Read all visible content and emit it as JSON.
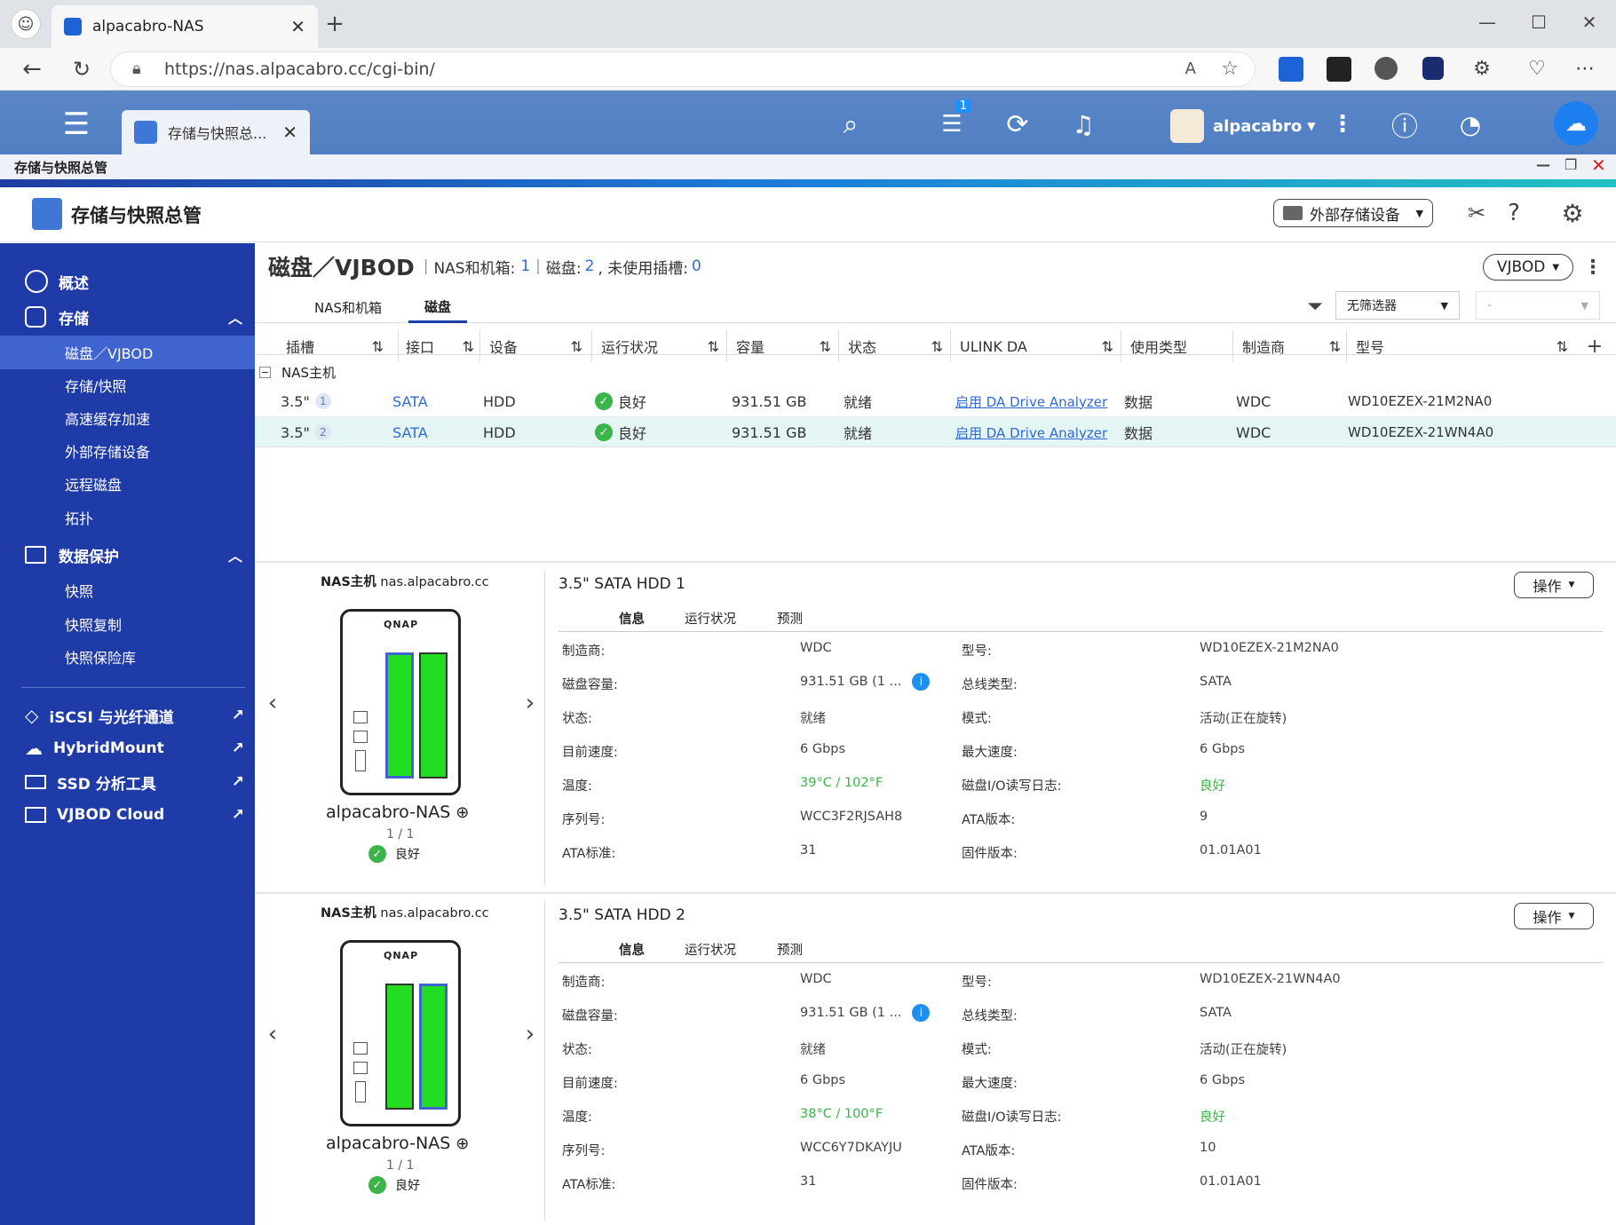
{
  "browser": {
    "tab_title": "alpacabro-NAS",
    "url": "https://nas.alpacabro.cc/cgi-bin/"
  },
  "qts": {
    "app_tab_label": "存储与快照总...",
    "notify_count": "1",
    "user": "alpacabro"
  },
  "window": {
    "title": "存储与快照总管",
    "app_title": "存储与快照总管",
    "external_btn": "外部存储设备"
  },
  "sidebar": {
    "overview": "概述",
    "storage": "存储",
    "storage_items": [
      "磁盘／VJBOD",
      "存储/快照",
      "高速缓存加速",
      "外部存储设备",
      "远程磁盘",
      "拓扑"
    ],
    "data_protection": "数据保护",
    "dp_items": [
      "快照",
      "快照复制",
      "快照保险库"
    ],
    "links": [
      "iSCSI 与光纤通道",
      "HybridMount",
      "SSD 分析工具",
      "VJBOD Cloud"
    ]
  },
  "header": {
    "title": "磁盘／VJBOD",
    "nas_label": "NAS和机箱:",
    "nas_count": "1",
    "disk_label": "磁盘:",
    "disk_count": "2",
    "unused_label": ", 未使用插槽:",
    "unused_count": "0",
    "vjbod_btn": "VJBOD"
  },
  "tabs": [
    "NAS和机箱",
    "磁盘"
  ],
  "filter": {
    "select": "无筛选器",
    "second": "-"
  },
  "columns": [
    "插槽",
    "接口",
    "设备",
    "运行状况",
    "容量",
    "状态",
    "ULINK DA",
    "使用类型",
    "制造商",
    "型号"
  ],
  "group": "NAS主机",
  "rows": [
    {
      "slot": "3.5\"",
      "num": "1",
      "iface": "SATA",
      "device": "HDD",
      "health": "良好",
      "capacity": "931.51 GB",
      "state": "就绪",
      "ulink": "启用 DA Drive Analyzer",
      "usage": "数据",
      "maker": "WDC",
      "model": "WD10EZEX-21M2NA0"
    },
    {
      "slot": "3.5\"",
      "num": "2",
      "iface": "SATA",
      "device": "HDD",
      "health": "良好",
      "capacity": "931.51 GB",
      "state": "就绪",
      "ulink": "启用 DA Drive Analyzer",
      "usage": "数据",
      "maker": "WDC",
      "model": "WD10EZEX-21WN4A0"
    }
  ],
  "panels": [
    {
      "host_label": "NAS主机",
      "host": "nas.alpacabro.cc",
      "device_name": "alpacabro-NAS",
      "page": "1 / 1",
      "health": "良好",
      "brand": "QNAP",
      "title": "3.5\" SATA HDD 1",
      "op": "操作",
      "tabs": [
        "信息",
        "运行状况",
        "预测"
      ],
      "labels": [
        "制造商:",
        "磁盘容量:",
        "状态:",
        "目前速度:",
        "温度:",
        "序列号:",
        "ATA标准:"
      ],
      "values": [
        "WDC",
        "931.51 GB (1 ...",
        "就绪",
        "6 Gbps",
        "39°C / 102°F",
        "WCC3F2RJSAH8",
        "31"
      ],
      "labels2": [
        "型号:",
        "总线类型:",
        "模式:",
        "最大速度:",
        "磁盘I/O读写日志:",
        "ATA版本:",
        "固件版本:"
      ],
      "values2": [
        "WD10EZEX-21M2NA0",
        "SATA",
        "活动(正在旋转)",
        "6 Gbps",
        "良好",
        "9",
        "01.01A01"
      ]
    },
    {
      "host_label": "NAS主机",
      "host": "nas.alpacabro.cc",
      "device_name": "alpacabro-NAS",
      "page": "1 / 1",
      "health": "良好",
      "brand": "QNAP",
      "title": "3.5\" SATA HDD 2",
      "op": "操作",
      "tabs": [
        "信息",
        "运行状况",
        "预测"
      ],
      "labels": [
        "制造商:",
        "磁盘容量:",
        "状态:",
        "目前速度:",
        "温度:",
        "序列号:",
        "ATA标准:"
      ],
      "values": [
        "WDC",
        "931.51 GB (1 ...",
        "就绪",
        "6 Gbps",
        "38°C / 100°F",
        "WCC6Y7DKAYJU",
        "31"
      ],
      "labels2": [
        "型号:",
        "总线类型:",
        "模式:",
        "最大速度:",
        "磁盘I/O读写日志:",
        "ATA版本:",
        "固件版本:"
      ],
      "values2": [
        "WD10EZEX-21WN4A0",
        "SATA",
        "活动(正在旋转)",
        "6 Gbps",
        "良好",
        "10",
        "01.01A01"
      ]
    }
  ],
  "colors": {
    "sidebar": "#1f3ba8",
    "accent_green": "#3bb54a",
    "link": "#2f6bd6"
  }
}
